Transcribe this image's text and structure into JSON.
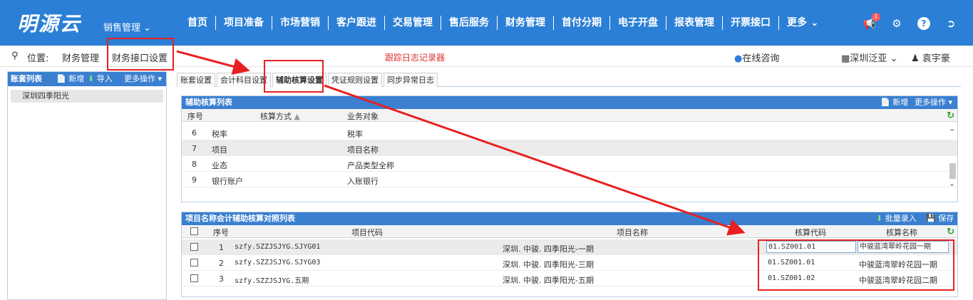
{
  "app": {
    "logo": "明源云",
    "module_menu": "销售管理 ⌄"
  },
  "nav": [
    "首页",
    "项目准备",
    "市场营销",
    "客户跟进",
    "交易管理",
    "售后服务",
    "财务管理",
    "首付分期",
    "电子开盘",
    "报表管理",
    "开票接口",
    "更多 ⌄"
  ],
  "top_icons": {
    "notify_count": "1"
  },
  "breadcrumb": {
    "pin": "⚲",
    "label": "位置:",
    "parent": "财务管理",
    "current": "财务接口设置"
  },
  "trace_link": "跟踪日志记录器",
  "online_consult": "在线咨询",
  "company": "深圳泛亚",
  "user_name": "袁宇豪",
  "left_panel": {
    "title": "账套列表",
    "add": "新增",
    "import": "导入",
    "more": "更多操作 ▾",
    "items": [
      "深圳四季阳光"
    ]
  },
  "tabs": [
    "账套设置",
    "会计科目设置",
    "辅助核算设置",
    "凭证规则设置",
    "同步异常日志"
  ],
  "aux_list": {
    "title": "辅助核算列表",
    "add": "新增",
    "more": "更多操作 ▾",
    "headers": {
      "seq": "序号",
      "method": "核算方式",
      "object": "业务对象"
    },
    "rows": [
      {
        "seq": "6",
        "method": "税率",
        "object": "税率"
      },
      {
        "seq": "7",
        "method": "项目",
        "object": "项目名称"
      },
      {
        "seq": "8",
        "method": "业态",
        "object": "产品类型全称"
      },
      {
        "seq": "9",
        "method": "银行账户",
        "object": "入账银行"
      }
    ]
  },
  "map_list": {
    "title": "项目名称会计辅助核算对照列表",
    "batch": "批量录入",
    "save": "保存",
    "headers": {
      "seq": "序号",
      "code": "项目代码",
      "name": "项目名称",
      "acc_code": "核算代码",
      "acc_name": "核算名称"
    },
    "rows": [
      {
        "seq": "1",
        "code": "szfy.SZZJSJYG.SJYG01",
        "name": "深圳. 中骏. 四季阳光-一期",
        "acc_code": "01.SZ001.01",
        "acc_name": "中骏蓝湾翠岭花园一期"
      },
      {
        "seq": "2",
        "code": "szfy.SZZJSJYG.SJYG03",
        "name": "深圳. 中骏. 四季阳光-三期",
        "acc_code": "01.SZ001.01",
        "acc_name": "中骏蓝湾翠岭花园一期"
      },
      {
        "seq": "3",
        "code": "szfy.SZZJSJYG.五期",
        "name": "深圳. 中骏. 四季阳光-五期",
        "acc_code": "01.SZ001.02",
        "acc_name": "中骏蓝湾翠岭花园二期"
      }
    ]
  },
  "colors": {
    "brand": "#2b7fd6",
    "panel_head": "#3a7fd0",
    "annotation": "#e82020"
  }
}
